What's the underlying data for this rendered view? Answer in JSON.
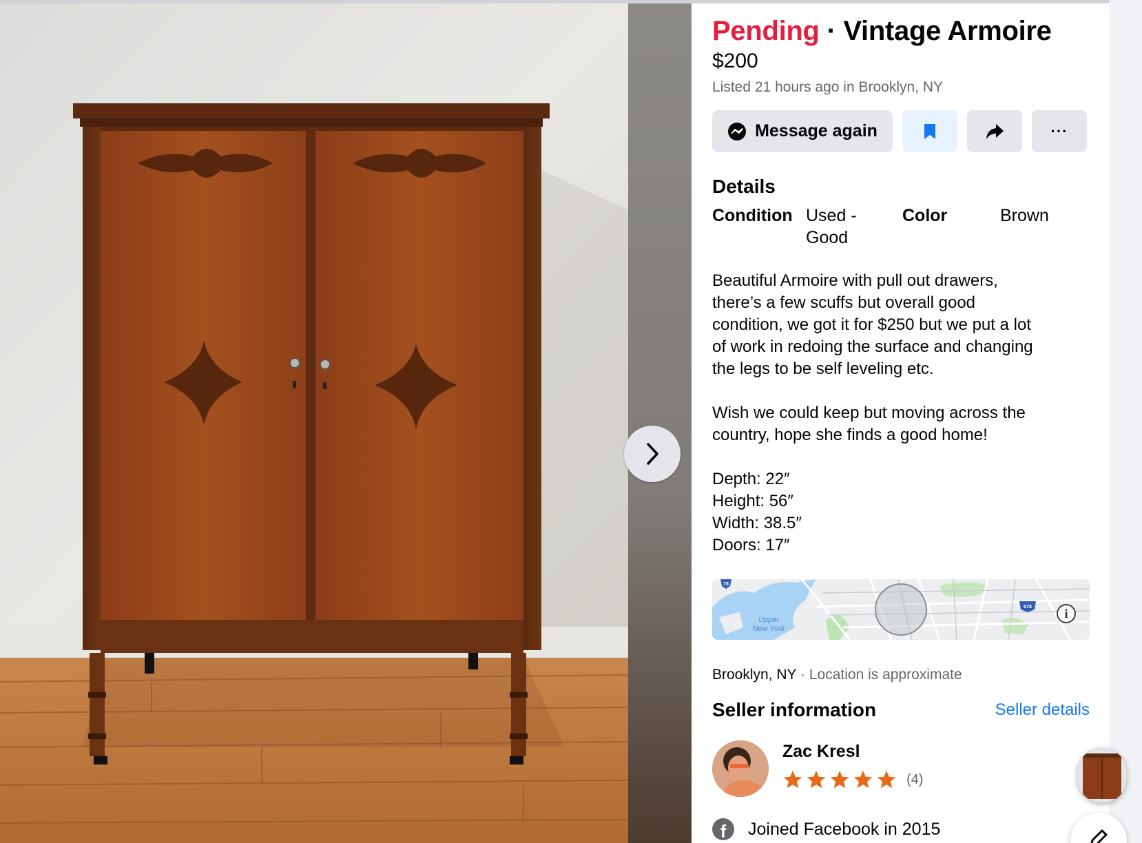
{
  "listing": {
    "status": "Pending",
    "separator": "·",
    "title": "Vintage Armoire",
    "price": "$200",
    "listed": "Listed 21 hours ago in Brooklyn, NY"
  },
  "actions": {
    "message_label": "Message again",
    "save_icon": "bookmark-icon",
    "share_icon": "share-arrow-icon",
    "more_label": "···"
  },
  "details": {
    "heading": "Details",
    "condition_label": "Condition",
    "condition_value_line1": "Used -",
    "condition_value_line2": "Good",
    "color_label": "Color",
    "color_value": "Brown"
  },
  "description": {
    "p1_lines": [
      "Beautiful Armoire with pull out drawers,",
      "there’s a few scuffs but overall good",
      "condition, we got it for $250 but we put a lot",
      "of work in redoing the surface and changing",
      "the legs to be self leveling etc."
    ],
    "p2_lines": [
      "Wish we could keep but moving across the",
      "country, hope she finds a good home!"
    ],
    "dims": [
      "Depth: 22″",
      "Height: 56″",
      "Width: 38.5″",
      "Doors: 17″"
    ]
  },
  "map": {
    "water_label_line1": "Upper",
    "water_label_line2": "New York",
    "shield_1": "78",
    "shield_2": "678",
    "info_icon": "i"
  },
  "location": {
    "city": "Brooklyn, NY",
    "dot": " · ",
    "approx": "Location is approximate"
  },
  "seller": {
    "heading": "Seller information",
    "details_link": "Seller details",
    "name": "Zac Kresl",
    "rating": 5,
    "rating_count": "(4)",
    "joined": "Joined Facebook in 2015"
  },
  "colors": {
    "pending": "#e41e3f",
    "link": "#1877f2",
    "star": "#e86a17",
    "button_bg": "#e4e6eb",
    "save_bg": "#e7f3ff"
  }
}
